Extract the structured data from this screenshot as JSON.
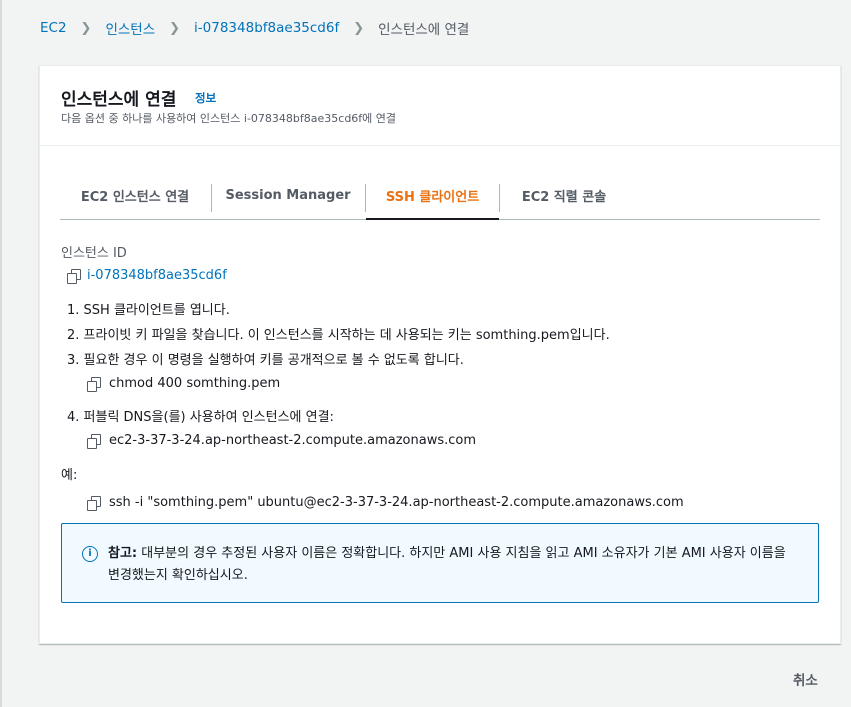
{
  "breadcrumb": {
    "items": [
      "EC2",
      "인스턴스",
      "i-078348bf8ae35cd6f"
    ],
    "current": "인스턴스에 연결"
  },
  "header": {
    "title": "인스턴스에 연결",
    "info_link": "정보",
    "description": "다음 옵션 중 하나를 사용하여 인스턴스 i-078348bf8ae35cd6f에 연결"
  },
  "tabs": [
    {
      "label": "EC2 인스턴스 연결"
    },
    {
      "label": "Session Manager"
    },
    {
      "label": "SSH 클라이언트",
      "active": true
    },
    {
      "label": "EC2 직렬 콘솔"
    }
  ],
  "instance": {
    "label": "인스턴스 ID",
    "id": "i-078348bf8ae35cd6f"
  },
  "steps": [
    "1. SSH 클라이언트를 엽니다.",
    "2. 프라이빗 키 파일을 찾습니다. 이 인스턴스를 시작하는 데 사용되는 키는 somthing.pem입니다.",
    "3. 필요한 경우 이 명령을 실행하여 키를 공개적으로 볼 수 없도록 합니다.",
    "4. 퍼블릭 DNS을(를) 사용하여 인스턴스에 연결:"
  ],
  "commands": {
    "chmod": "chmod 400 somthing.pem",
    "dns": "ec2-3-37-3-24.ap-northeast-2.compute.amazonaws.com",
    "example_label": "예:",
    "ssh": "ssh -i \"somthing.pem\" ubuntu@ec2-3-37-3-24.ap-northeast-2.compute.amazonaws.com"
  },
  "alert": {
    "prefix": "참고:",
    "text": "대부분의 경우 추정된 사용자 이름은 정확합니다. 하지만 AMI 사용 지침을 읽고 AMI 소유자가 기본 AMI 사용자 이름을 변경했는지 확인하십시오."
  },
  "footer": {
    "cancel_label": "취소"
  },
  "colors": {
    "accent": "#ec7211",
    "link": "#0073bb",
    "alert_bg": "#f1faff"
  }
}
